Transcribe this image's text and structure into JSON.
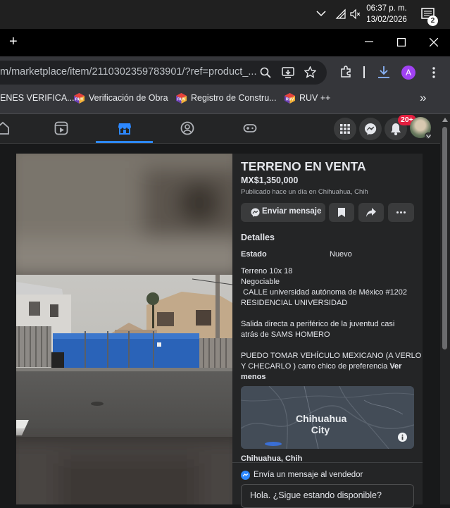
{
  "taskbar": {
    "time": "06:37 p. m.",
    "date": "13/02/2026",
    "notification_count": "2"
  },
  "browser": {
    "url": "m/marketplace/item/2110302359783901/?ref=product_...",
    "new_tab_symbol": "+",
    "profile_initial": "A",
    "bookmarks": [
      {
        "label": "ENES VERIFICA..."
      },
      {
        "label": "Verificación de Obra"
      },
      {
        "label": "Registro de Constru..."
      },
      {
        "label": "RUV ++"
      }
    ],
    "bookmarks_overflow": "»"
  },
  "facebook": {
    "notification_badge": "20+"
  },
  "listing": {
    "title": "TERRENO EN VENTA",
    "price": "MX$1,350,000",
    "posted": "Publicado hace un día en Chihuahua, Chih",
    "send_message_label": "Enviar mensaje",
    "details_heading": "Detalles",
    "condition_label": "Estado",
    "condition_value": "Nuevo",
    "description_lines": [
      "Terreno 10x 18",
      "Negociable",
      " CALLE universidad autónoma de México #1202",
      "RESIDENCIAL UNIVERSIDAD",
      "Salida directa a periférico de la juventud casi",
      "atrás de SAMS HOMERO",
      "PUEDO TOMAR VEHÍCULO MEXICANO (A VERLO",
      "Y CHECARLO ) carro chico de preferencia "
    ],
    "see_less_part1": "Ver",
    "see_less_part2": "menos",
    "map_city_line1": "Chihuahua",
    "map_city_line2": "City",
    "location": "Chihuahua, Chih",
    "seller_prompt": "Envía un mensaje al vendedor",
    "message_value": "Hola. ¿Sigue estando disponible?"
  },
  "colors": {
    "accent": "#2d88ff",
    "badge": "#e41e3f",
    "panel_bg": "#242526",
    "page_bg": "#18191a"
  }
}
